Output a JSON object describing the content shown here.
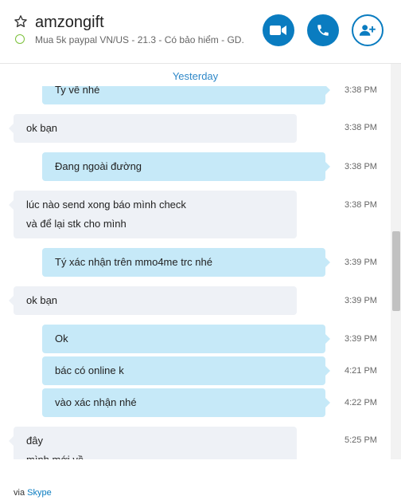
{
  "header": {
    "title": "amzongift",
    "mood": "Mua 5k paypal VN/US - 21.3 - Có bảo hiểm - GD...",
    "video_icon": "video-camera-icon",
    "call_icon": "phone-icon",
    "add_icon": "add-person-icon"
  },
  "chat": {
    "date_separator": "Yesterday",
    "messages": [
      {
        "text": "Ty về nhé",
        "time": "3:38 PM",
        "dir": "out"
      },
      {
        "text": "ok bạn",
        "time": "3:38 PM",
        "dir": "in"
      },
      {
        "text": "Đang ngoài đường",
        "time": "3:38 PM",
        "dir": "out"
      },
      {
        "line1": "lúc nào send xong báo mình check",
        "line2": "và để lại stk cho mình",
        "time": "3:38 PM",
        "dir": "in"
      },
      {
        "text": "Tý xác nhận trên mmo4me trc nhé",
        "time": "3:39 PM",
        "dir": "out"
      },
      {
        "text": "ok bạn",
        "time": "3:39 PM",
        "dir": "in"
      },
      {
        "text": "Ok",
        "time": "3:39 PM",
        "dir": "out"
      },
      {
        "text": "bác có online k",
        "time": "4:21 PM",
        "dir": "out"
      },
      {
        "text": "vào xác nhận nhé",
        "time": "4:22 PM",
        "dir": "out"
      },
      {
        "line1": "đây",
        "line2": "mình mới về",
        "time": "5:25 PM",
        "dir": "in"
      }
    ]
  },
  "footer": {
    "via": "via",
    "skype": "Skype"
  }
}
